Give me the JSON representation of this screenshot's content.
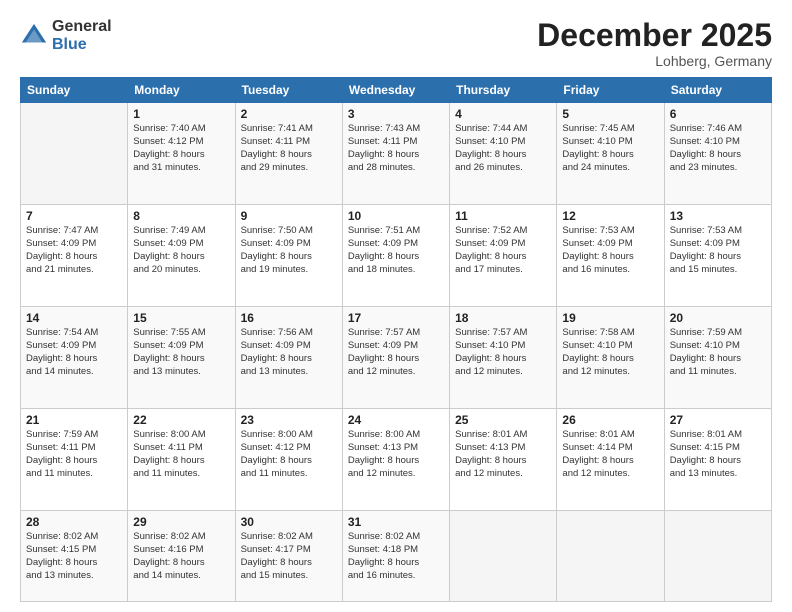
{
  "header": {
    "logo_general": "General",
    "logo_blue": "Blue",
    "month_year": "December 2025",
    "location": "Lohberg, Germany"
  },
  "weekdays": [
    "Sunday",
    "Monday",
    "Tuesday",
    "Wednesday",
    "Thursday",
    "Friday",
    "Saturday"
  ],
  "weeks": [
    [
      {
        "day": "",
        "info": ""
      },
      {
        "day": "1",
        "info": "Sunrise: 7:40 AM\nSunset: 4:12 PM\nDaylight: 8 hours\nand 31 minutes."
      },
      {
        "day": "2",
        "info": "Sunrise: 7:41 AM\nSunset: 4:11 PM\nDaylight: 8 hours\nand 29 minutes."
      },
      {
        "day": "3",
        "info": "Sunrise: 7:43 AM\nSunset: 4:11 PM\nDaylight: 8 hours\nand 28 minutes."
      },
      {
        "day": "4",
        "info": "Sunrise: 7:44 AM\nSunset: 4:10 PM\nDaylight: 8 hours\nand 26 minutes."
      },
      {
        "day": "5",
        "info": "Sunrise: 7:45 AM\nSunset: 4:10 PM\nDaylight: 8 hours\nand 24 minutes."
      },
      {
        "day": "6",
        "info": "Sunrise: 7:46 AM\nSunset: 4:10 PM\nDaylight: 8 hours\nand 23 minutes."
      }
    ],
    [
      {
        "day": "7",
        "info": "Sunrise: 7:47 AM\nSunset: 4:09 PM\nDaylight: 8 hours\nand 21 minutes."
      },
      {
        "day": "8",
        "info": "Sunrise: 7:49 AM\nSunset: 4:09 PM\nDaylight: 8 hours\nand 20 minutes."
      },
      {
        "day": "9",
        "info": "Sunrise: 7:50 AM\nSunset: 4:09 PM\nDaylight: 8 hours\nand 19 minutes."
      },
      {
        "day": "10",
        "info": "Sunrise: 7:51 AM\nSunset: 4:09 PM\nDaylight: 8 hours\nand 18 minutes."
      },
      {
        "day": "11",
        "info": "Sunrise: 7:52 AM\nSunset: 4:09 PM\nDaylight: 8 hours\nand 17 minutes."
      },
      {
        "day": "12",
        "info": "Sunrise: 7:53 AM\nSunset: 4:09 PM\nDaylight: 8 hours\nand 16 minutes."
      },
      {
        "day": "13",
        "info": "Sunrise: 7:53 AM\nSunset: 4:09 PM\nDaylight: 8 hours\nand 15 minutes."
      }
    ],
    [
      {
        "day": "14",
        "info": "Sunrise: 7:54 AM\nSunset: 4:09 PM\nDaylight: 8 hours\nand 14 minutes."
      },
      {
        "day": "15",
        "info": "Sunrise: 7:55 AM\nSunset: 4:09 PM\nDaylight: 8 hours\nand 13 minutes."
      },
      {
        "day": "16",
        "info": "Sunrise: 7:56 AM\nSunset: 4:09 PM\nDaylight: 8 hours\nand 13 minutes."
      },
      {
        "day": "17",
        "info": "Sunrise: 7:57 AM\nSunset: 4:09 PM\nDaylight: 8 hours\nand 12 minutes."
      },
      {
        "day": "18",
        "info": "Sunrise: 7:57 AM\nSunset: 4:10 PM\nDaylight: 8 hours\nand 12 minutes."
      },
      {
        "day": "19",
        "info": "Sunrise: 7:58 AM\nSunset: 4:10 PM\nDaylight: 8 hours\nand 12 minutes."
      },
      {
        "day": "20",
        "info": "Sunrise: 7:59 AM\nSunset: 4:10 PM\nDaylight: 8 hours\nand 11 minutes."
      }
    ],
    [
      {
        "day": "21",
        "info": "Sunrise: 7:59 AM\nSunset: 4:11 PM\nDaylight: 8 hours\nand 11 minutes."
      },
      {
        "day": "22",
        "info": "Sunrise: 8:00 AM\nSunset: 4:11 PM\nDaylight: 8 hours\nand 11 minutes."
      },
      {
        "day": "23",
        "info": "Sunrise: 8:00 AM\nSunset: 4:12 PM\nDaylight: 8 hours\nand 11 minutes."
      },
      {
        "day": "24",
        "info": "Sunrise: 8:00 AM\nSunset: 4:13 PM\nDaylight: 8 hours\nand 12 minutes."
      },
      {
        "day": "25",
        "info": "Sunrise: 8:01 AM\nSunset: 4:13 PM\nDaylight: 8 hours\nand 12 minutes."
      },
      {
        "day": "26",
        "info": "Sunrise: 8:01 AM\nSunset: 4:14 PM\nDaylight: 8 hours\nand 12 minutes."
      },
      {
        "day": "27",
        "info": "Sunrise: 8:01 AM\nSunset: 4:15 PM\nDaylight: 8 hours\nand 13 minutes."
      }
    ],
    [
      {
        "day": "28",
        "info": "Sunrise: 8:02 AM\nSunset: 4:15 PM\nDaylight: 8 hours\nand 13 minutes."
      },
      {
        "day": "29",
        "info": "Sunrise: 8:02 AM\nSunset: 4:16 PM\nDaylight: 8 hours\nand 14 minutes."
      },
      {
        "day": "30",
        "info": "Sunrise: 8:02 AM\nSunset: 4:17 PM\nDaylight: 8 hours\nand 15 minutes."
      },
      {
        "day": "31",
        "info": "Sunrise: 8:02 AM\nSunset: 4:18 PM\nDaylight: 8 hours\nand 16 minutes."
      },
      {
        "day": "",
        "info": ""
      },
      {
        "day": "",
        "info": ""
      },
      {
        "day": "",
        "info": ""
      }
    ]
  ]
}
